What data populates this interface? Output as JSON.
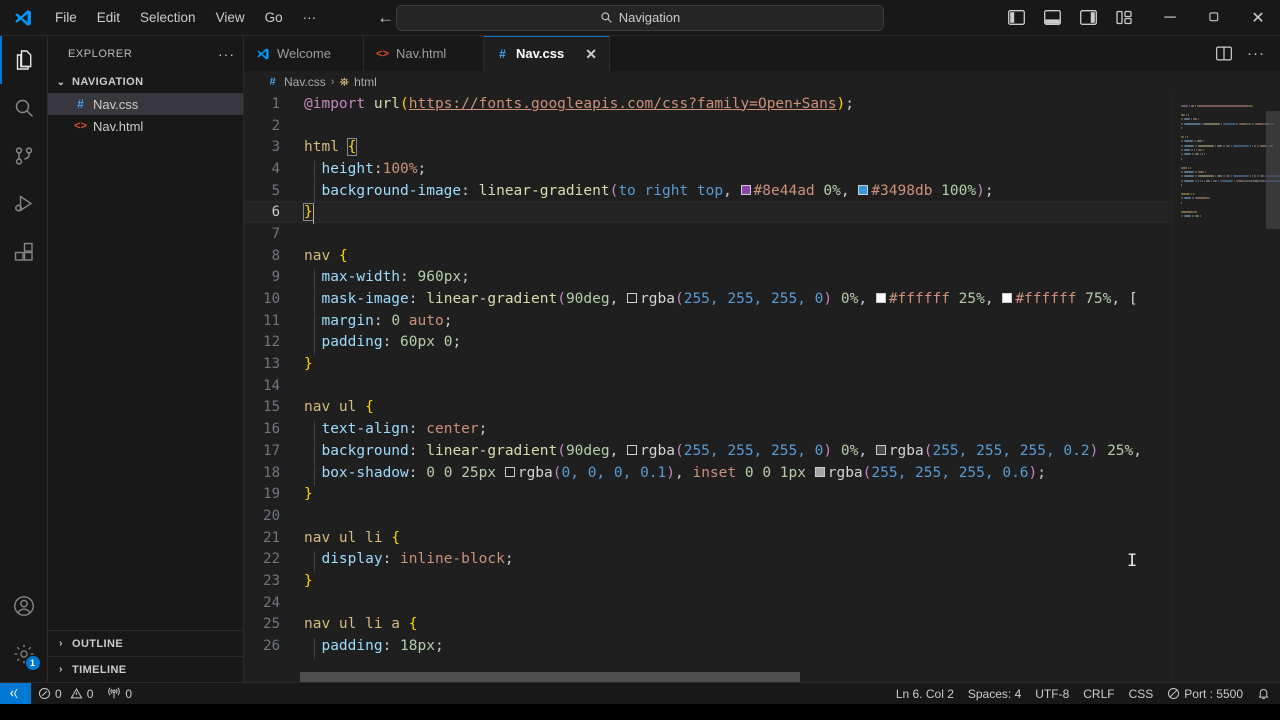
{
  "titlebar": {
    "logo_icon": "vscode-logo-icon",
    "menus": [
      {
        "label": "File",
        "name": "menu-file"
      },
      {
        "label": "Edit",
        "name": "menu-edit"
      },
      {
        "label": "Selection",
        "name": "menu-selection"
      },
      {
        "label": "View",
        "name": "menu-view"
      },
      {
        "label": "Go",
        "name": "menu-go"
      },
      {
        "label": "···",
        "name": "menu-more"
      }
    ],
    "nav_back": "←",
    "nav_forward": "→",
    "search": {
      "icon": "search-icon",
      "text": "Navigation"
    },
    "layout_icons": [
      {
        "name": "toggle-primary-sidebar-icon",
        "title": "Toggle Primary Side Bar"
      },
      {
        "name": "toggle-panel-icon",
        "title": "Toggle Panel"
      },
      {
        "name": "toggle-secondary-sidebar-icon",
        "title": "Toggle Secondary Side Bar"
      },
      {
        "name": "customize-layout-icon",
        "title": "Customize Layout"
      }
    ],
    "window_controls": {
      "minimize": "─",
      "maximize": "❐",
      "close": "✕"
    }
  },
  "activitybar": {
    "items": [
      {
        "name": "activity-explorer",
        "icon": "files-icon",
        "active": true
      },
      {
        "name": "activity-search",
        "icon": "search-icon",
        "active": false
      },
      {
        "name": "activity-source-control",
        "icon": "source-control-icon",
        "active": false
      },
      {
        "name": "activity-run-debug",
        "icon": "run-and-debug-icon",
        "active": false
      },
      {
        "name": "activity-extensions",
        "icon": "extensions-icon",
        "active": false
      }
    ],
    "bottom": [
      {
        "name": "activity-accounts",
        "icon": "account-icon",
        "badge": ""
      },
      {
        "name": "activity-manage",
        "icon": "gear-icon",
        "badge": "1"
      }
    ]
  },
  "sidebar": {
    "title": "EXPLORER",
    "more_actions": "···",
    "folder": {
      "label": "NAVIGATION",
      "twisty": "⌄",
      "expanded": true
    },
    "files": [
      {
        "label": "Nav.css",
        "icon": "css-file-icon",
        "icon_glyph": "#",
        "icon_color": "#42a5f5",
        "selected": true
      },
      {
        "label": "Nav.html",
        "icon": "html-file-icon",
        "icon_glyph": "<>",
        "icon_color": "#e44d26",
        "selected": false
      }
    ],
    "sections": [
      {
        "label": "OUTLINE",
        "twisty": "›",
        "name": "sidebar-section-outline"
      },
      {
        "label": "TIMELINE",
        "twisty": "›",
        "name": "sidebar-section-timeline"
      }
    ]
  },
  "editor": {
    "tabs": [
      {
        "label": "Welcome",
        "icon": "vscode-logo-icon",
        "icon_glyph": "",
        "icon_color": "#0098ff",
        "active": false,
        "closable": false
      },
      {
        "label": "Nav.html",
        "icon": "html-file-icon",
        "icon_glyph": "<>",
        "icon_color": "#e44d26",
        "active": false,
        "closable": false
      },
      {
        "label": "Nav.css",
        "icon": "css-file-icon",
        "icon_glyph": "#",
        "icon_color": "#42a5f5",
        "active": true,
        "closable": true,
        "close_glyph": "✕"
      }
    ],
    "tab_actions": [
      {
        "name": "split-editor-right-icon"
      },
      {
        "name": "more-editor-actions-icon",
        "glyph": "···"
      }
    ],
    "breadcrumbs": [
      {
        "label": "Nav.css",
        "icon_glyph": "#",
        "icon_color": "#42a5f5",
        "name": "breadcrumb-file"
      },
      {
        "label": "html",
        "icon_glyph": "⛯",
        "icon_color": "#e8c07d",
        "name": "breadcrumb-symbol"
      }
    ],
    "breadcrumb_sep": "›",
    "language": "CSS",
    "lines": [
      {
        "n": 1,
        "tokens": [
          {
            "t": "@import",
            "c": "kw"
          },
          {
            "t": " ",
            "c": "white"
          },
          {
            "t": "url",
            "c": "fn"
          },
          {
            "t": "(",
            "c": "brace"
          },
          {
            "t": "https://fonts.googleapis.com/css?family=Open+Sans",
            "c": "url"
          },
          {
            "t": ")",
            "c": "brace"
          },
          {
            "t": ";",
            "c": "punc"
          }
        ]
      },
      {
        "n": 2,
        "tokens": []
      },
      {
        "n": 3,
        "tokens": [
          {
            "t": "html",
            "c": "sel"
          },
          {
            "t": " ",
            "c": "white"
          },
          {
            "t": "{",
            "c": "brace",
            "match": true
          }
        ]
      },
      {
        "n": 4,
        "indent": true,
        "tokens": [
          {
            "t": "  ",
            "c": "white"
          },
          {
            "t": "height",
            "c": "prop"
          },
          {
            "t": ":",
            "c": "punc"
          },
          {
            "t": "100%",
            "c": "val"
          },
          {
            "t": ";",
            "c": "punc"
          }
        ]
      },
      {
        "n": 5,
        "indent": true,
        "tokens": [
          {
            "t": "  ",
            "c": "white"
          },
          {
            "t": "background-image",
            "c": "prop"
          },
          {
            "t": ": ",
            "c": "punc"
          },
          {
            "t": "linear-gradient",
            "c": "fn"
          },
          {
            "t": "(",
            "c": "kw"
          },
          {
            "t": "to right top",
            "c": "blue"
          },
          {
            "t": ", ",
            "c": "punc"
          },
          {
            "t": "#8e44ad",
            "c": "val",
            "swatch": "#8e44ad"
          },
          {
            "t": " ",
            "c": "white"
          },
          {
            "t": "0%",
            "c": "num"
          },
          {
            "t": ", ",
            "c": "punc"
          },
          {
            "t": "#3498db",
            "c": "val",
            "swatch": "#3498db"
          },
          {
            "t": " ",
            "c": "white"
          },
          {
            "t": "100%",
            "c": "num"
          },
          {
            "t": ")",
            "c": "kw"
          },
          {
            "t": ";",
            "c": "punc"
          }
        ]
      },
      {
        "n": 6,
        "current": true,
        "cursor_col": 2,
        "tokens": [
          {
            "t": "}",
            "c": "brace",
            "match": true
          }
        ]
      },
      {
        "n": 7,
        "tokens": []
      },
      {
        "n": 8,
        "tokens": [
          {
            "t": "nav",
            "c": "sel"
          },
          {
            "t": " ",
            "c": "white"
          },
          {
            "t": "{",
            "c": "brace"
          }
        ]
      },
      {
        "n": 9,
        "indent": true,
        "tokens": [
          {
            "t": "  ",
            "c": "white"
          },
          {
            "t": "max-width",
            "c": "prop"
          },
          {
            "t": ": ",
            "c": "punc"
          },
          {
            "t": "960px",
            "c": "num"
          },
          {
            "t": ";",
            "c": "punc"
          }
        ]
      },
      {
        "n": 10,
        "indent": true,
        "tokens": [
          {
            "t": "  ",
            "c": "white"
          },
          {
            "t": "mask-image",
            "c": "prop"
          },
          {
            "t": ": ",
            "c": "punc"
          },
          {
            "t": "linear-gradient",
            "c": "fn"
          },
          {
            "t": "(",
            "c": "kw"
          },
          {
            "t": "90deg",
            "c": "num"
          },
          {
            "t": ", ",
            "c": "punc"
          },
          {
            "t": "rgba",
            "c": "white",
            "swatch": "#ffffff00"
          },
          {
            "t": "(",
            "c": "kw"
          },
          {
            "t": "255, 255, 255, 0",
            "c": "blue"
          },
          {
            "t": ")",
            "c": "kw"
          },
          {
            "t": " ",
            "c": "white"
          },
          {
            "t": "0%",
            "c": "num"
          },
          {
            "t": ", ",
            "c": "punc"
          },
          {
            "t": "#ffffff",
            "c": "val",
            "swatch": "#ffffff"
          },
          {
            "t": " ",
            "c": "white"
          },
          {
            "t": "25%",
            "c": "num"
          },
          {
            "t": ", ",
            "c": "punc"
          },
          {
            "t": "#ffffff",
            "c": "val",
            "swatch": "#ffffff"
          },
          {
            "t": " ",
            "c": "white"
          },
          {
            "t": "75%",
            "c": "num"
          },
          {
            "t": ", ",
            "c": "punc"
          },
          {
            "t": "[",
            "c": "white"
          }
        ]
      },
      {
        "n": 11,
        "indent": true,
        "tokens": [
          {
            "t": "  ",
            "c": "white"
          },
          {
            "t": "margin",
            "c": "prop"
          },
          {
            "t": ": ",
            "c": "punc"
          },
          {
            "t": "0",
            "c": "num"
          },
          {
            "t": " ",
            "c": "white"
          },
          {
            "t": "auto",
            "c": "val"
          },
          {
            "t": ";",
            "c": "punc"
          }
        ]
      },
      {
        "n": 12,
        "indent": true,
        "tokens": [
          {
            "t": "  ",
            "c": "white"
          },
          {
            "t": "padding",
            "c": "prop"
          },
          {
            "t": ": ",
            "c": "punc"
          },
          {
            "t": "60px",
            "c": "num"
          },
          {
            "t": " ",
            "c": "white"
          },
          {
            "t": "0",
            "c": "num"
          },
          {
            "t": ";",
            "c": "punc"
          }
        ]
      },
      {
        "n": 13,
        "tokens": [
          {
            "t": "}",
            "c": "brace"
          }
        ]
      },
      {
        "n": 14,
        "tokens": []
      },
      {
        "n": 15,
        "tokens": [
          {
            "t": "nav ul",
            "c": "sel"
          },
          {
            "t": " ",
            "c": "white"
          },
          {
            "t": "{",
            "c": "brace"
          }
        ]
      },
      {
        "n": 16,
        "indent": true,
        "tokens": [
          {
            "t": "  ",
            "c": "white"
          },
          {
            "t": "text-align",
            "c": "prop"
          },
          {
            "t": ": ",
            "c": "punc"
          },
          {
            "t": "center",
            "c": "val"
          },
          {
            "t": ";",
            "c": "punc"
          }
        ]
      },
      {
        "n": 17,
        "indent": true,
        "tokens": [
          {
            "t": "  ",
            "c": "white"
          },
          {
            "t": "background",
            "c": "prop"
          },
          {
            "t": ": ",
            "c": "punc"
          },
          {
            "t": "linear-gradient",
            "c": "fn"
          },
          {
            "t": "(",
            "c": "kw"
          },
          {
            "t": "90deg",
            "c": "num"
          },
          {
            "t": ", ",
            "c": "punc"
          },
          {
            "t": "rgba",
            "c": "white",
            "swatch": "#ffffff00"
          },
          {
            "t": "(",
            "c": "kw"
          },
          {
            "t": "255, 255, 255, 0",
            "c": "blue"
          },
          {
            "t": ")",
            "c": "kw"
          },
          {
            "t": " ",
            "c": "white"
          },
          {
            "t": "0%",
            "c": "num"
          },
          {
            "t": ", ",
            "c": "punc"
          },
          {
            "t": "rgba",
            "c": "white",
            "swatch": "#ffffff33"
          },
          {
            "t": "(",
            "c": "kw"
          },
          {
            "t": "255, 255, 255, 0.2",
            "c": "blue"
          },
          {
            "t": ")",
            "c": "kw"
          },
          {
            "t": " ",
            "c": "white"
          },
          {
            "t": "25%",
            "c": "num"
          },
          {
            "t": ",",
            "c": "punc"
          }
        ]
      },
      {
        "n": 18,
        "indent": true,
        "tokens": [
          {
            "t": "  ",
            "c": "white"
          },
          {
            "t": "box-shadow",
            "c": "prop"
          },
          {
            "t": ": ",
            "c": "punc"
          },
          {
            "t": "0",
            "c": "num"
          },
          {
            "t": " ",
            "c": "white"
          },
          {
            "t": "0",
            "c": "num"
          },
          {
            "t": " ",
            "c": "white"
          },
          {
            "t": "25px",
            "c": "num"
          },
          {
            "t": " ",
            "c": "white"
          },
          {
            "t": "rgba",
            "c": "white",
            "swatch": "#0000001a"
          },
          {
            "t": "(",
            "c": "kw"
          },
          {
            "t": "0, 0, 0, 0.1",
            "c": "blue"
          },
          {
            "t": ")",
            "c": "kw"
          },
          {
            "t": ", ",
            "c": "punc"
          },
          {
            "t": "inset",
            "c": "val"
          },
          {
            "t": " ",
            "c": "white"
          },
          {
            "t": "0",
            "c": "num"
          },
          {
            "t": " ",
            "c": "white"
          },
          {
            "t": "0",
            "c": "num"
          },
          {
            "t": " ",
            "c": "white"
          },
          {
            "t": "1px",
            "c": "num"
          },
          {
            "t": " ",
            "c": "white"
          },
          {
            "t": "rgba",
            "c": "white",
            "swatch": "#ffffff99"
          },
          {
            "t": "(",
            "c": "kw"
          },
          {
            "t": "255, 255, 255, 0.6",
            "c": "blue"
          },
          {
            "t": ")",
            "c": "kw"
          },
          {
            "t": ";",
            "c": "punc"
          }
        ]
      },
      {
        "n": 19,
        "tokens": [
          {
            "t": "}",
            "c": "brace"
          }
        ]
      },
      {
        "n": 20,
        "tokens": []
      },
      {
        "n": 21,
        "tokens": [
          {
            "t": "nav ul li",
            "c": "sel"
          },
          {
            "t": " ",
            "c": "white"
          },
          {
            "t": "{",
            "c": "brace"
          }
        ]
      },
      {
        "n": 22,
        "indent": true,
        "tokens": [
          {
            "t": "  ",
            "c": "white"
          },
          {
            "t": "display",
            "c": "prop"
          },
          {
            "t": ": ",
            "c": "punc"
          },
          {
            "t": "inline-block",
            "c": "val"
          },
          {
            "t": ";",
            "c": "punc"
          }
        ]
      },
      {
        "n": 23,
        "tokens": [
          {
            "t": "}",
            "c": "brace"
          }
        ]
      },
      {
        "n": 24,
        "tokens": []
      },
      {
        "n": 25,
        "tokens": [
          {
            "t": "nav ul li a",
            "c": "sel"
          },
          {
            "t": " ",
            "c": "white"
          },
          {
            "t": "{",
            "c": "brace"
          }
        ]
      },
      {
        "n": 26,
        "indent": true,
        "tokens": [
          {
            "t": "  ",
            "c": "white"
          },
          {
            "t": "padding",
            "c": "prop"
          },
          {
            "t": ": ",
            "c": "punc"
          },
          {
            "t": "18px",
            "c": "num"
          },
          {
            "t": ";",
            "c": "punc"
          }
        ]
      }
    ]
  },
  "statusbar": {
    "remote_icon": "remote-window-icon",
    "left": [
      {
        "name": "status-problems",
        "icon": "error-icon",
        "errors": "0",
        "warnings": "0",
        "glyph_error": "⊗",
        "glyph_warning": "⚠"
      },
      {
        "name": "status-ports",
        "icon": "radio-tower-icon",
        "value": "0"
      }
    ],
    "right": [
      {
        "name": "status-cursor-position",
        "label": "Ln 6. Col 2"
      },
      {
        "name": "status-indentation",
        "label": "Spaces: 4"
      },
      {
        "name": "status-encoding",
        "label": "UTF-8"
      },
      {
        "name": "status-eol",
        "label": "CRLF"
      },
      {
        "name": "status-language-mode",
        "label": "CSS"
      },
      {
        "name": "status-live-server-port",
        "label": "Port : 5500",
        "icon": "circle-slash-icon"
      },
      {
        "name": "status-notifications",
        "icon": "bell-icon"
      }
    ]
  },
  "colors": {
    "accent": "#0078d4",
    "editor_bg": "#1f1f1f",
    "chrome_bg": "#181818",
    "selection": "#37373d"
  }
}
